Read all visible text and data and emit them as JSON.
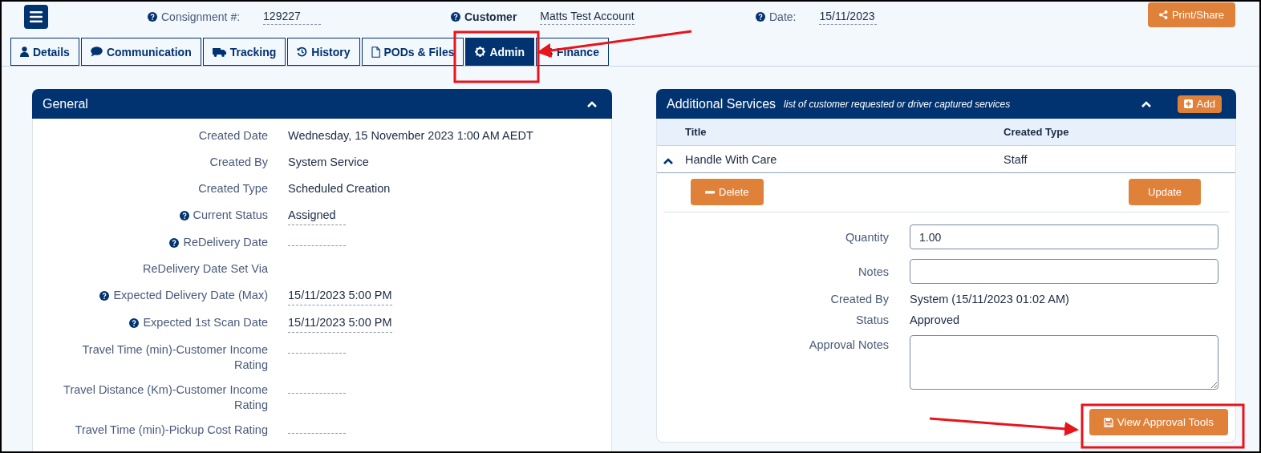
{
  "header": {
    "fields": [
      {
        "label": "Consignment #:",
        "value": "129227",
        "help": true,
        "emphasis": false
      },
      {
        "label": "Customer",
        "value": "Matts Test Account",
        "help": true,
        "emphasis": true
      },
      {
        "label": "Date:",
        "value": "15/11/2023",
        "help": true,
        "emphasis": false
      }
    ],
    "print_button": "Print/Share"
  },
  "tabs": [
    {
      "label": "Details",
      "selected": false
    },
    {
      "label": "Communication",
      "selected": false
    },
    {
      "label": "Tracking",
      "selected": false
    },
    {
      "label": "History",
      "selected": false
    },
    {
      "label": "PODs & Files",
      "selected": false
    },
    {
      "label": "Admin",
      "selected": true
    },
    {
      "label": "Finance",
      "selected": false
    }
  ],
  "general": {
    "title": "General",
    "rows": [
      {
        "label": "Created Date",
        "value": "Wednesday, 15 November 2023 1:00 AM AEDT",
        "help": false,
        "editable": false
      },
      {
        "label": "Created By",
        "value": "System Service",
        "help": false,
        "editable": false
      },
      {
        "label": "Created Type",
        "value": "Scheduled Creation",
        "help": false,
        "editable": false
      },
      {
        "label": "Current Status",
        "value": "Assigned",
        "help": true,
        "editable": true
      },
      {
        "label": "ReDelivery Date",
        "help": true,
        "editable": true
      },
      {
        "label": "ReDelivery Date Set Via",
        "help": false,
        "editable": false
      },
      {
        "label": "Expected Delivery Date (Max)",
        "value": "15/11/2023 5:00 PM",
        "help": true,
        "editable": true
      },
      {
        "label": "Expected 1st Scan Date",
        "value": "15/11/2023 5:00 PM",
        "help": true,
        "editable": true
      },
      {
        "label": "Travel Time (min)-Customer Income Rating",
        "help": false,
        "editable": true
      },
      {
        "label": "Travel Distance (Km)-Customer Income Rating",
        "help": false,
        "editable": true
      },
      {
        "label": "Travel Time (min)-Pickup Cost Rating",
        "help": false,
        "editable": true
      }
    ]
  },
  "additional_services": {
    "title": "Additional Services",
    "subtitle": "list of customer requested or driver captured services",
    "add_button": "Add",
    "columns": [
      "Title",
      "Created Type"
    ],
    "rows": [
      {
        "title": "Handle With Care",
        "created_type": "Staff",
        "expanded": true
      }
    ],
    "delete_button": "Delete",
    "update_button": "Update",
    "fields": [
      {
        "kind": "input",
        "label": "Quantity",
        "value": "1.00"
      },
      {
        "kind": "input",
        "label": "Notes"
      },
      {
        "kind": "text",
        "label": "Created By",
        "value": "System (15/11/2023 01:02 AM)"
      },
      {
        "kind": "text",
        "label": "Status",
        "value": "Approved"
      },
      {
        "kind": "textarea",
        "label": "Approval Notes"
      }
    ],
    "view_button": "View Approval Tools"
  }
}
